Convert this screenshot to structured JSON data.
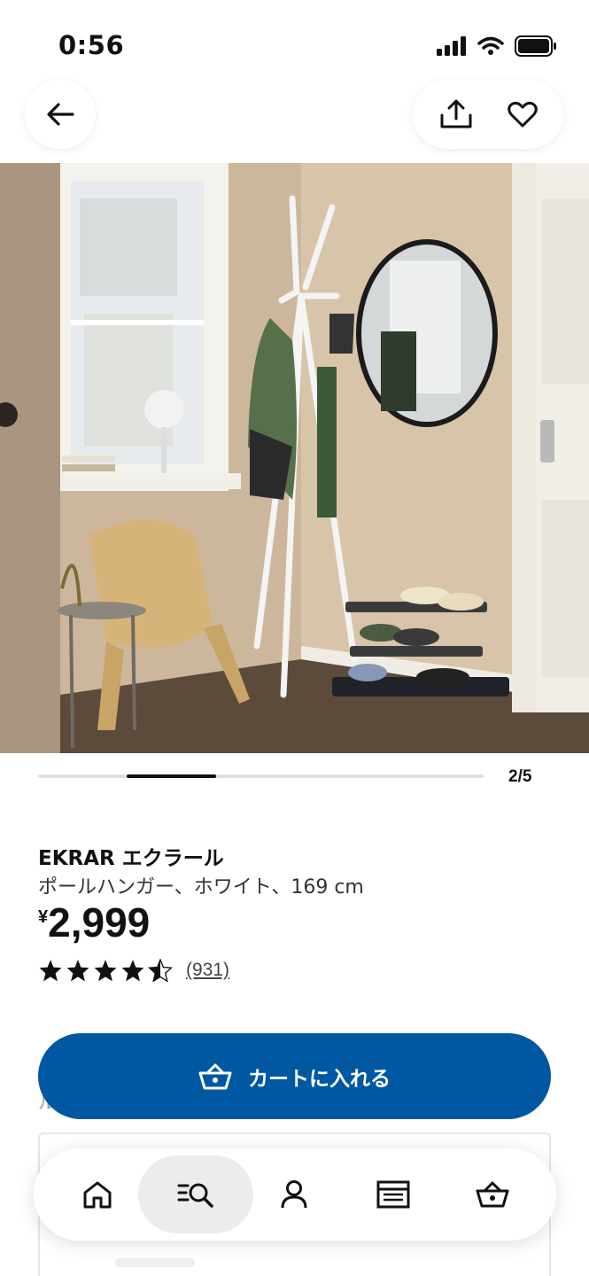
{
  "status_bar": {
    "time": "0:56"
  },
  "product": {
    "name": "EKRAR エクラール",
    "description": "ポールハンガー、ホワイト、169 cm",
    "currency_symbol": "¥",
    "price": "2,999",
    "rating_stars": 4.5,
    "rating_max": 5,
    "review_count": "(931)"
  },
  "gallery": {
    "counter": "2/5",
    "current": 2,
    "total": 5
  },
  "cart_button": {
    "label": "カートに入れる"
  },
  "bottom_nav": {
    "items": [
      {
        "icon": "home-icon",
        "active": false
      },
      {
        "icon": "search-list-icon",
        "active": true
      },
      {
        "icon": "profile-icon",
        "active": false
      },
      {
        "icon": "store-icon",
        "active": false
      },
      {
        "icon": "basket-icon",
        "active": false
      }
    ]
  },
  "colors": {
    "primary_blue": "#0058a3",
    "text": "#111111"
  }
}
